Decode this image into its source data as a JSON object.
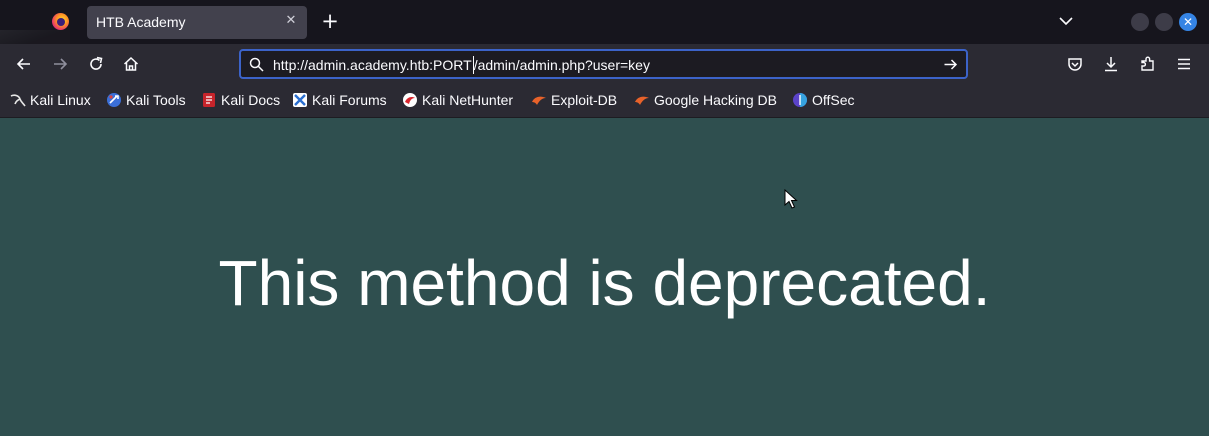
{
  "browser": {
    "tab": {
      "title": "HTB Academy",
      "close_glyph": "✕"
    },
    "new_tab_glyph": "+",
    "window_close_glyph": "✕",
    "url": {
      "before_caret": "http://admin.academy.htb:PORT",
      "after_caret": "/admin/admin.php?user=key"
    },
    "bookmarks": [
      {
        "label": "Kali Linux",
        "icon": "kali-dragon-icon"
      },
      {
        "label": "Kali Tools",
        "icon": "kali-tools-icon"
      },
      {
        "label": "Kali Docs",
        "icon": "kali-docs-icon"
      },
      {
        "label": "Kali Forums",
        "icon": "kali-forums-icon"
      },
      {
        "label": "Kali NetHunter",
        "icon": "kali-nethunter-icon"
      },
      {
        "label": "Exploit-DB",
        "icon": "exploit-db-icon"
      },
      {
        "label": "Google Hacking DB",
        "icon": "ghdb-icon"
      },
      {
        "label": "OffSec",
        "icon": "offsec-icon"
      }
    ]
  },
  "page": {
    "message": "This method is deprecated.",
    "background": "#2f4f4f"
  },
  "colors": {
    "accent": "#3c63c9",
    "toolbar": "#2b2a33",
    "tabstrip": "#16151d"
  }
}
